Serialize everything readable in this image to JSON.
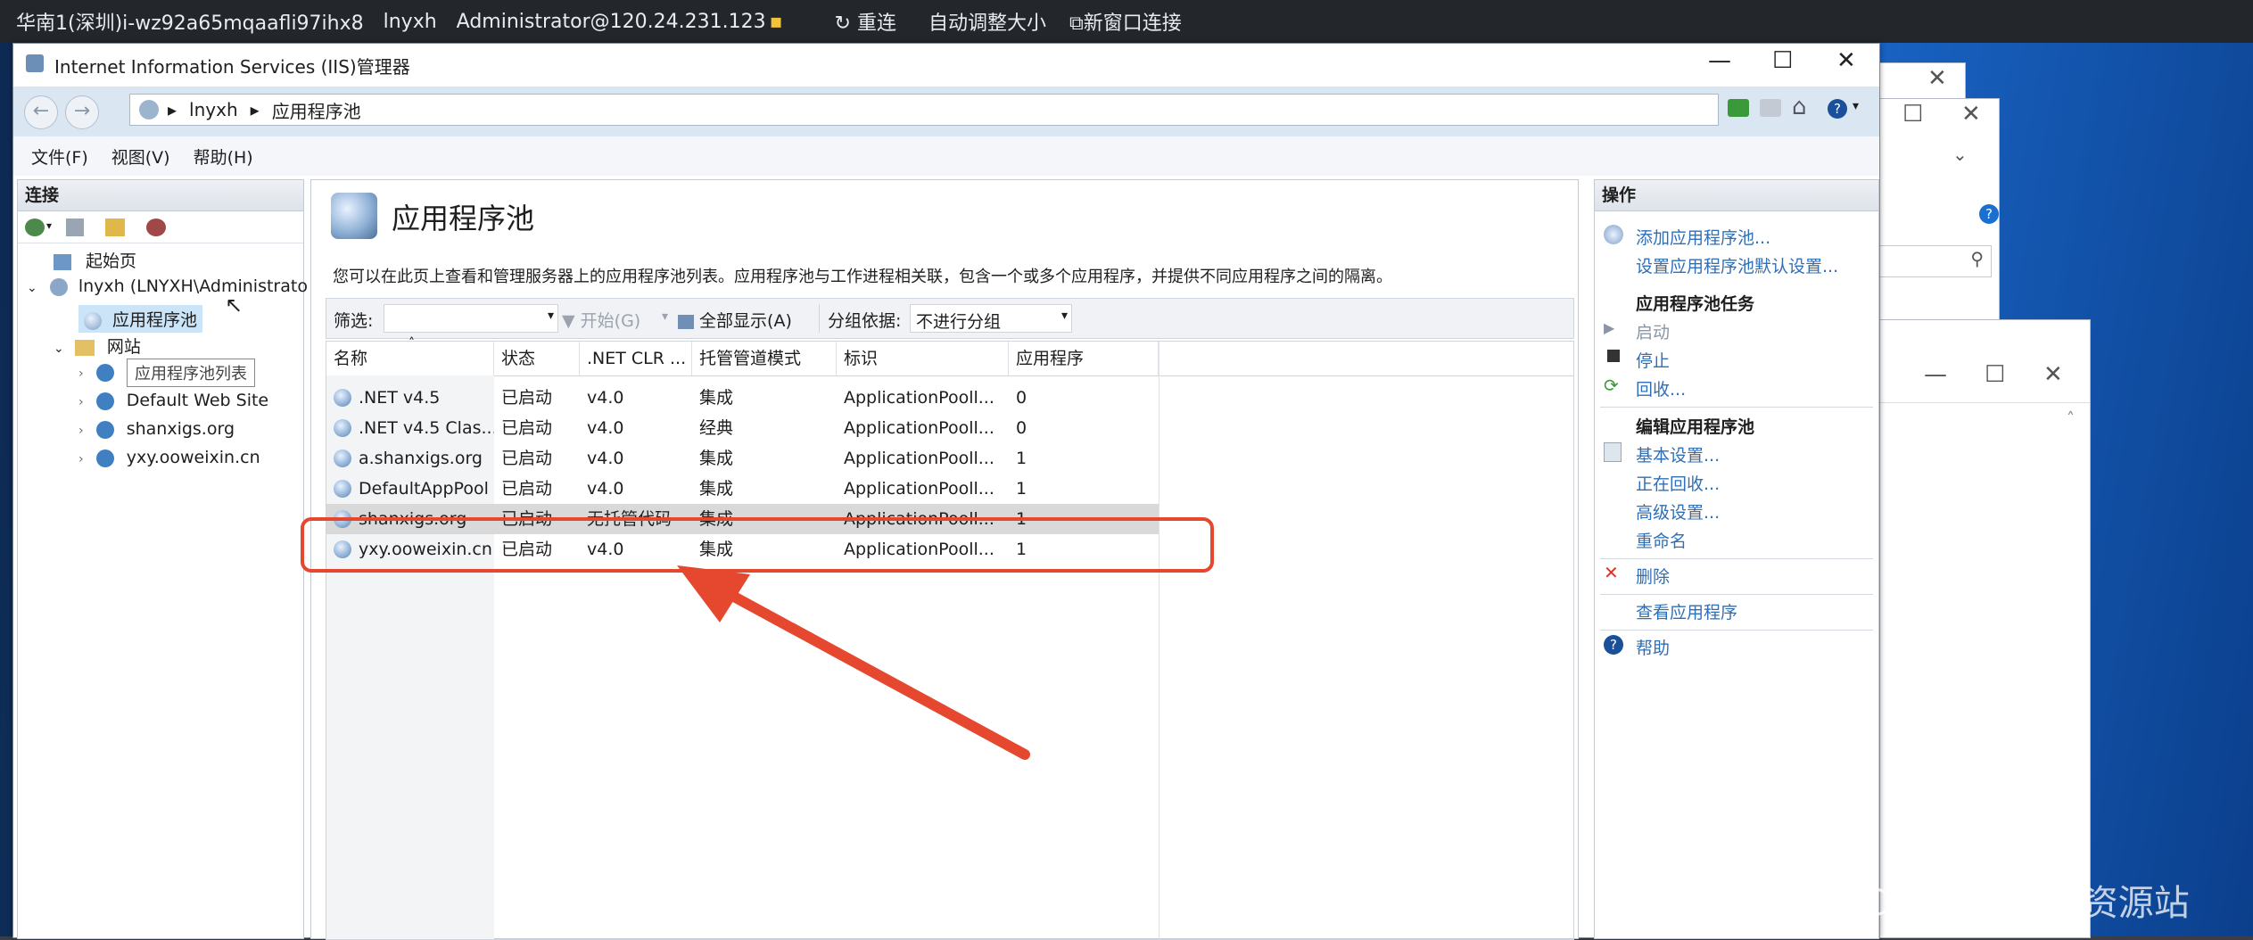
{
  "remote_bar": {
    "host": "华南1(深圳)i-wz92a65mqaafli97ihx8",
    "name": "lnyxh",
    "user": "Administrator@120.24.231.123",
    "reconnect": "重连",
    "auto_resize": "自动调整大小",
    "new_window": "新窗口连接"
  },
  "window": {
    "title": "Internet Information Services (IIS)管理器",
    "breadcrumb": [
      "lnyxh",
      "应用程序池"
    ]
  },
  "menu": [
    "文件(F)",
    "视图(V)",
    "帮助(H)"
  ],
  "connections": {
    "header": "连接",
    "tree": [
      {
        "label": "起始页",
        "level": 1
      },
      {
        "label": "lnyxh (LNYXH\\Administrato",
        "level": 0
      },
      {
        "label": "应用程序池",
        "level": 2,
        "selected": true
      },
      {
        "label": "网站",
        "level": 1
      },
      {
        "label": "Default Web Site",
        "level": 2
      },
      {
        "label": "shanxigs.org",
        "level": 2
      },
      {
        "label": "yxy.ooweixin.cn",
        "level": 2
      }
    ],
    "tooltip": "应用程序池列表"
  },
  "center": {
    "title": "应用程序池",
    "description": "您可以在此页上查看和管理服务器上的应用程序池列表。应用程序池与工作进程相关联，包含一个或多个应用程序，并提供不同应用程序之间的隔离。",
    "filter_label": "筛选:",
    "start_label": "开始(G)",
    "show_all": "全部显示(A)",
    "group_by_label": "分组依据:",
    "group_by_value": "不进行分组",
    "columns": [
      "名称",
      "状态",
      ".NET CLR ...",
      "托管管道模式",
      "标识",
      "应用程序"
    ],
    "rows": [
      {
        "name": ".NET v4.5",
        "status": "已启动",
        "clr": "v4.0",
        "pipeline": "集成",
        "identity": "ApplicationPooll...",
        "apps": "0"
      },
      {
        "name": ".NET v4.5 Clas...",
        "status": "已启动",
        "clr": "v4.0",
        "pipeline": "经典",
        "identity": "ApplicationPooll...",
        "apps": "0"
      },
      {
        "name": "a.shanxigs.org",
        "status": "已启动",
        "clr": "v4.0",
        "pipeline": "集成",
        "identity": "ApplicationPooll...",
        "apps": "1"
      },
      {
        "name": "DefaultAppPool",
        "status": "已启动",
        "clr": "v4.0",
        "pipeline": "集成",
        "identity": "ApplicationPooll...",
        "apps": "1"
      },
      {
        "name": "shanxigs.org",
        "status": "已启动",
        "clr": "无托管代码",
        "pipeline": "集成",
        "identity": "ApplicationPooll...",
        "apps": "1",
        "selected": true
      },
      {
        "name": "yxy.ooweixin.cn",
        "status": "已启动",
        "clr": "v4.0",
        "pipeline": "集成",
        "identity": "ApplicationPooll...",
        "apps": "1"
      }
    ]
  },
  "actions": {
    "header": "操作",
    "add_pool": "添加应用程序池...",
    "set_defaults": "设置应用程序池默认设置...",
    "pool_tasks": "应用程序池任务",
    "start": "启动",
    "stop": "停止",
    "recycle": "回收...",
    "edit_pool": "编辑应用程序池",
    "basic_settings": "基本设置...",
    "recycling": "正在回收...",
    "advanced_settings": "高级设置...",
    "rename": "重命名",
    "delete": "删除",
    "view_apps": "查看应用程序",
    "help": "帮助"
  },
  "watermark": "CSDN @阿巳资源站",
  "colors": {
    "highlight": "#e5472f",
    "selection": "#d9d9d9",
    "link": "#2f6fb7"
  }
}
